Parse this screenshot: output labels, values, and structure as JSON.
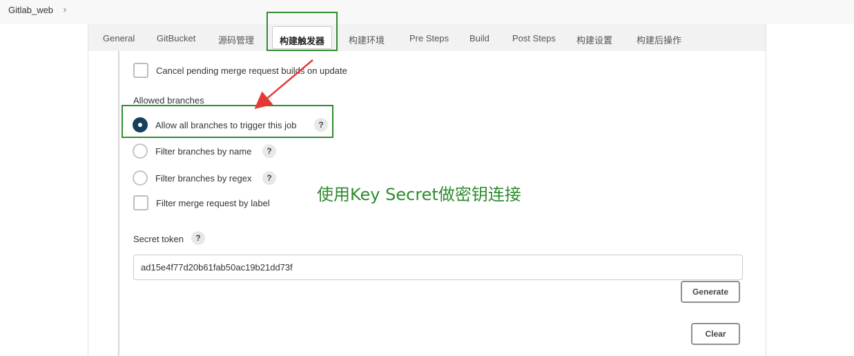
{
  "breadcrumb": {
    "job": "Gitlab_web",
    "separator": "›"
  },
  "tabs": [
    "General",
    "GitBucket",
    "源码管理",
    "构建触发器",
    "构建环境",
    "Pre Steps",
    "Build",
    "Post Steps",
    "构建设置",
    "构建后操作"
  ],
  "active_tab": "构建触发器",
  "options": {
    "cancel_pending": "Cancel pending merge request builds on update",
    "allowed_branches_title": "Allowed branches",
    "allow_all": "Allow all branches to trigger this job",
    "filter_by_name": "Filter branches by name",
    "filter_by_regex": "Filter branches by regex",
    "filter_by_label": "Filter merge request by label",
    "selected_branch_option": "Allow all branches to trigger this job"
  },
  "secret": {
    "label": "Secret token",
    "value": "ad15e4f77d20b61fab50ac19b21dd73f",
    "generate": "Generate",
    "clear": "Clear"
  },
  "help_glyph": "?",
  "annotation": "使用Key Secret做密钥连接",
  "colors": {
    "highlight": "#2e8b2e",
    "arrow": "#e53935",
    "radio_selected": "#14405c"
  },
  "icons": [
    "chevron-right-icon",
    "help-icon",
    "annotation-arrow-icon"
  ]
}
